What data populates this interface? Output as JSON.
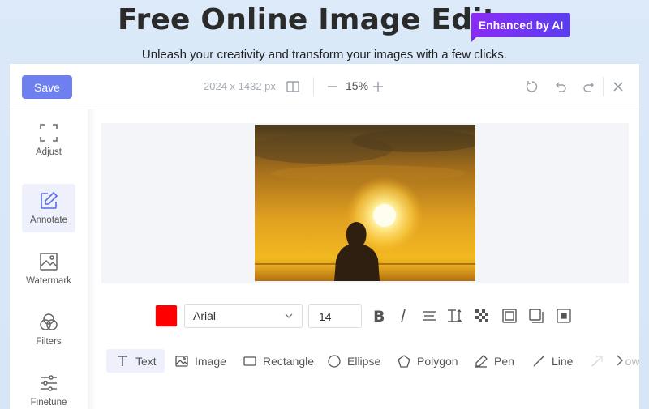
{
  "hero": {
    "title": "Free Online Image Editor",
    "badge": "Enhanced by AI",
    "subtitle": "Unleash your creativity and transform your images with a few clicks."
  },
  "topbar": {
    "save_label": "Save",
    "dimensions": "2024 x 1432 px",
    "zoom": "15%",
    "icons": [
      "compare-icon",
      "zoom-out-icon",
      "zoom-in-icon",
      "reset-icon",
      "undo-icon",
      "redo-icon",
      "close-icon"
    ]
  },
  "sidebar": {
    "items": [
      {
        "label": "Adjust",
        "icon": "crop-icon",
        "active": false
      },
      {
        "label": "Annotate",
        "icon": "edit-icon",
        "active": true
      },
      {
        "label": "Watermark",
        "icon": "watermark-icon",
        "active": false
      },
      {
        "label": "Filters",
        "icon": "filters-icon",
        "active": false
      },
      {
        "label": "Finetune",
        "icon": "sliders-icon",
        "active": false
      }
    ]
  },
  "props": {
    "color": "#ff0000",
    "font": "Arial",
    "size": "14",
    "icons": [
      "bold-icon",
      "italic-icon",
      "align-icon",
      "text-height-icon",
      "transparency-icon",
      "border-icon",
      "shadow-icon",
      "background-icon"
    ]
  },
  "tools": {
    "items": [
      {
        "label": "Text",
        "icon": "text-icon",
        "active": true
      },
      {
        "label": "Image",
        "icon": "image-icon",
        "active": false
      },
      {
        "label": "Rectangle",
        "icon": "rectangle-icon",
        "active": false
      },
      {
        "label": "Ellipse",
        "icon": "ellipse-icon",
        "active": false
      },
      {
        "label": "Polygon",
        "icon": "polygon-icon",
        "active": false
      },
      {
        "label": "Pen",
        "icon": "pen-icon",
        "active": false
      },
      {
        "label": "Line",
        "icon": "line-icon",
        "active": false
      },
      {
        "label": "Arrow",
        "icon": "arrow-icon",
        "active": false
      }
    ]
  },
  "colors": {
    "accent": "#6e7ff0",
    "badge_start": "#8b2cf5",
    "badge_end": "#5b3df0"
  }
}
